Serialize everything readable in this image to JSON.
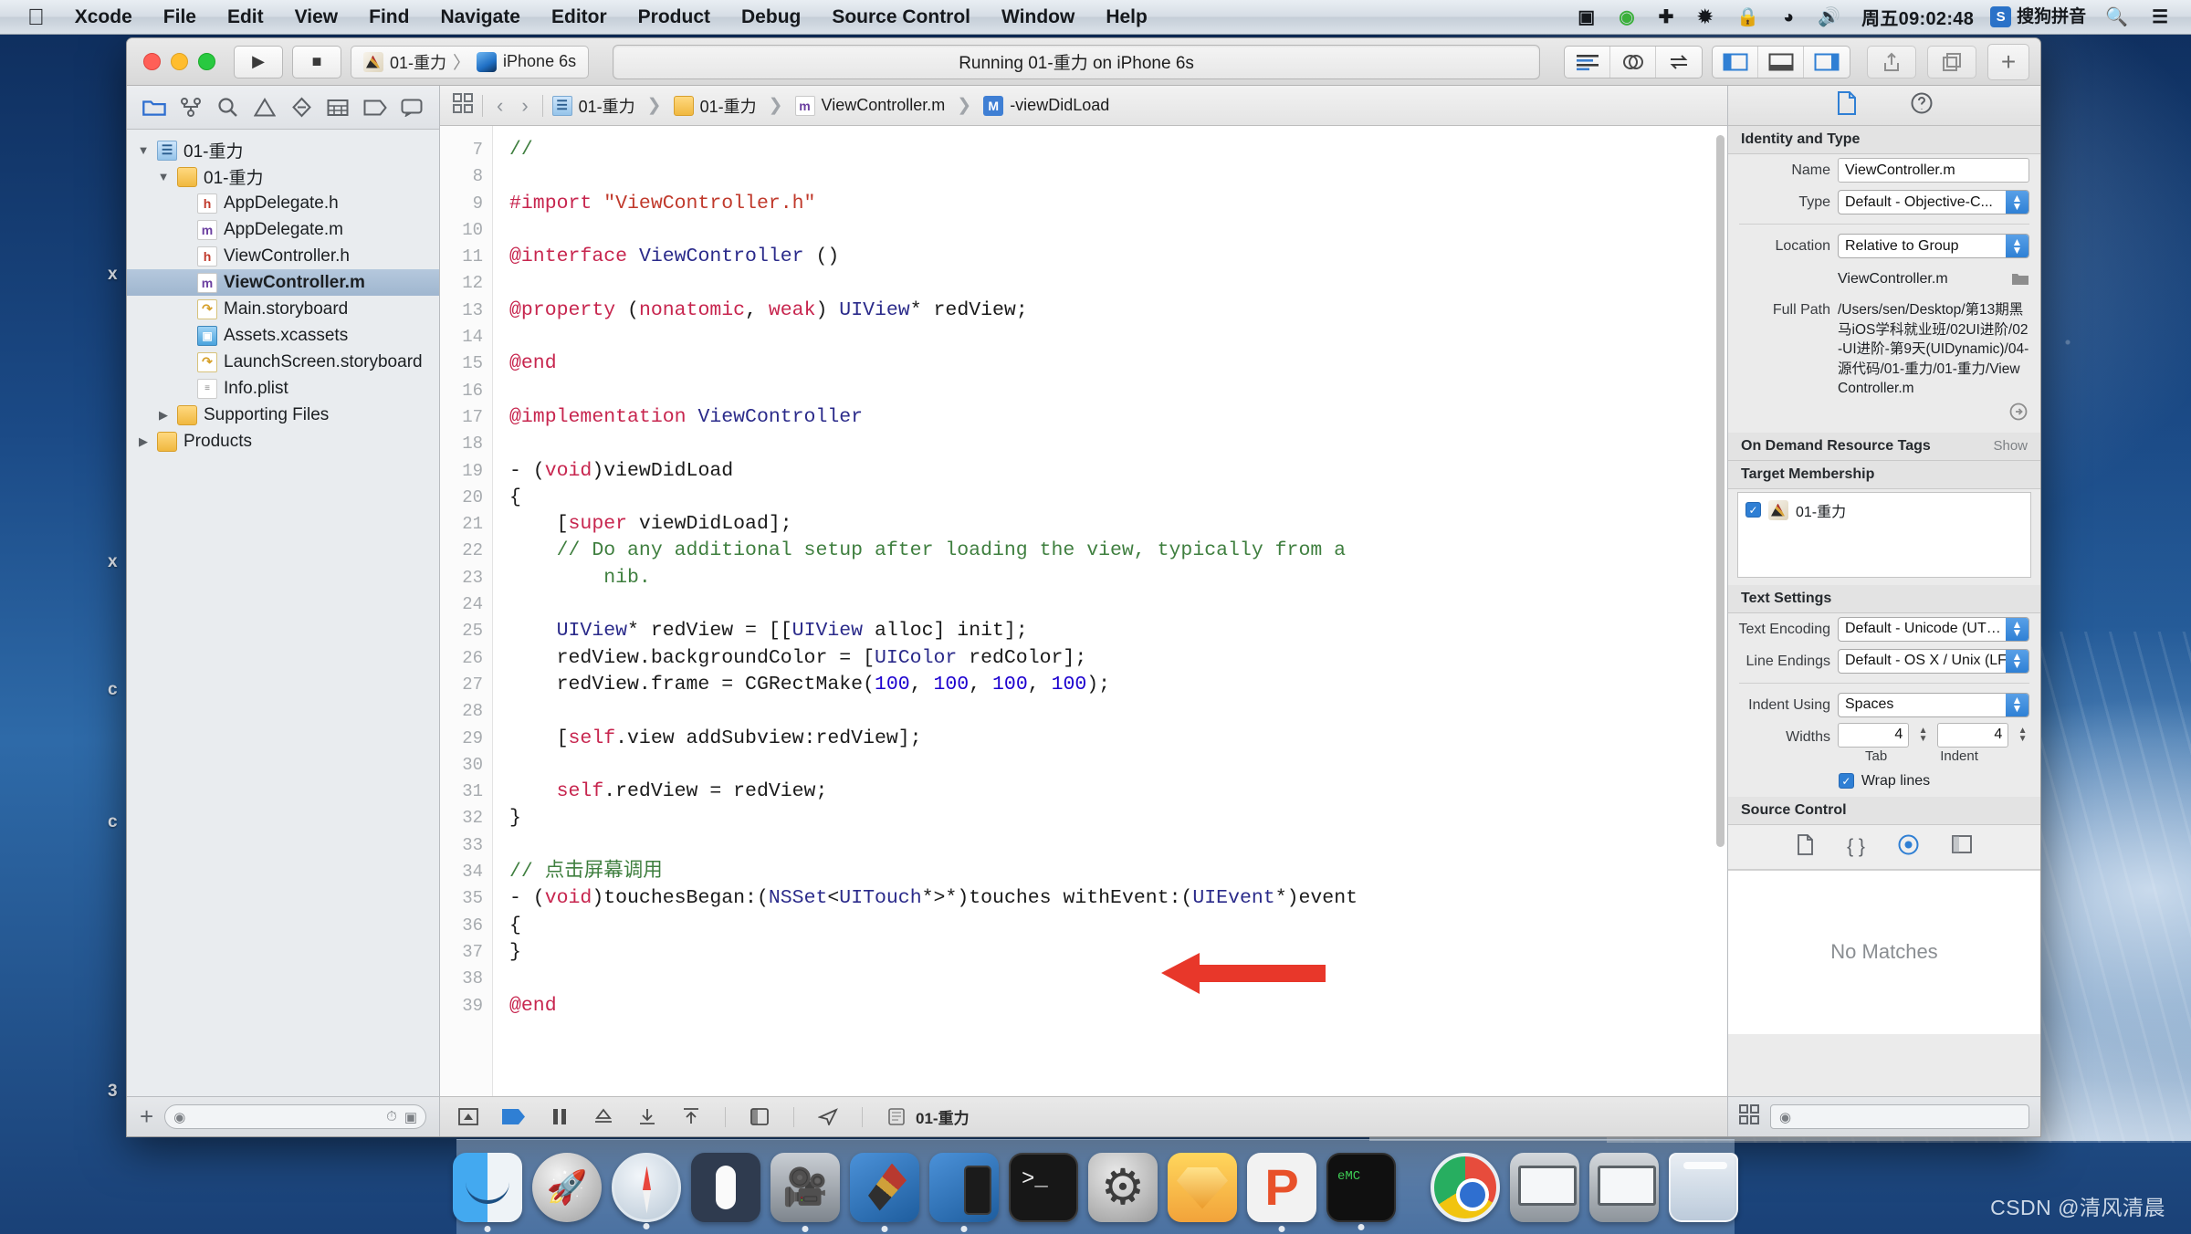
{
  "menubar": {
    "apple_icon": "apple-logo",
    "items": [
      "Xcode",
      "File",
      "Edit",
      "View",
      "Find",
      "Navigate",
      "Editor",
      "Product",
      "Debug",
      "Source Control",
      "Window",
      "Help"
    ],
    "status_icons": [
      "screen-recording-icon",
      "play-circle-icon",
      "airplane-icon",
      "bluetooth-icon",
      "lock-icon",
      "wifi-icon",
      "volume-icon"
    ],
    "clock": "周五09:02:48",
    "ime_badge": "S",
    "ime_label": "搜狗拼音",
    "search_icon": "search-icon",
    "control_center_icon": "list-icon"
  },
  "toolbar": {
    "run_icon": "play-icon",
    "stop_icon": "stop-icon",
    "scheme_name": "01-重力",
    "scheme_separator": "〉",
    "destination": "iPhone 6s",
    "status_text": "Running 01-重力 on iPhone 6s",
    "editor_modes": [
      "standard-editor-icon",
      "assistant-editor-icon",
      "version-editor-icon"
    ],
    "panel_toggles": [
      "navigator-toggle-icon",
      "debug-area-toggle-icon",
      "inspector-toggle-icon"
    ],
    "share_icon": "share-icon",
    "organizer_icon": "organizer-icon",
    "add_icon": "+"
  },
  "navigator": {
    "tabs": [
      "folder-icon",
      "source-control-icon",
      "search-icon",
      "warning-icon",
      "test-icon",
      "debug-icon",
      "breakpoint-icon",
      "report-icon"
    ],
    "active_tab_index": 0,
    "tree": [
      {
        "label": "01-重力",
        "icon": "project-icon",
        "depth": 0,
        "twisty": "▼",
        "selected": false
      },
      {
        "label": "01-重力",
        "icon": "folder-icon",
        "depth": 1,
        "twisty": "▼",
        "selected": false
      },
      {
        "label": "AppDelegate.h",
        "icon": "header-file-icon",
        "depth": 2,
        "twisty": "",
        "selected": false
      },
      {
        "label": "AppDelegate.m",
        "icon": "implementation-file-icon",
        "depth": 2,
        "twisty": "",
        "selected": false
      },
      {
        "label": "ViewController.h",
        "icon": "header-file-icon",
        "depth": 2,
        "twisty": "",
        "selected": false
      },
      {
        "label": "ViewController.m",
        "icon": "implementation-file-icon",
        "depth": 2,
        "twisty": "",
        "selected": true
      },
      {
        "label": "Main.storyboard",
        "icon": "storyboard-icon",
        "depth": 2,
        "twisty": "",
        "selected": false
      },
      {
        "label": "Assets.xcassets",
        "icon": "assets-icon",
        "depth": 2,
        "twisty": "",
        "selected": false
      },
      {
        "label": "LaunchScreen.storyboard",
        "icon": "storyboard-icon",
        "depth": 2,
        "twisty": "",
        "selected": false
      },
      {
        "label": "Info.plist",
        "icon": "plist-icon",
        "depth": 2,
        "twisty": "",
        "selected": false
      },
      {
        "label": "Supporting Files",
        "icon": "folder-icon",
        "depth": 1,
        "twisty": "▶",
        "selected": false
      },
      {
        "label": "Products",
        "icon": "folder-icon",
        "depth": 0,
        "twisty": "▶",
        "selected": false
      }
    ],
    "footer": {
      "add_icon": "+",
      "filter_placeholder": "",
      "filter_value": "",
      "filter_left_icon": "filter-icon",
      "filter_right_icon": "recent-files-icon"
    }
  },
  "jumpbar": {
    "grid_icon": "related-items-icon",
    "back_icon": "‹",
    "forward_icon": "›",
    "crumbs": [
      {
        "label": "01-重力",
        "icon": "project-icon"
      },
      {
        "label": "01-重力",
        "icon": "folder-icon"
      },
      {
        "label": "ViewController.m",
        "icon": "implementation-file-icon"
      },
      {
        "label": "-viewDidLoad",
        "icon": "method-badge-icon"
      }
    ]
  },
  "code": {
    "first_line_number": 7,
    "lines": [
      {
        "n": 7,
        "tokens": [
          {
            "t": "//",
            "c": "cm"
          }
        ]
      },
      {
        "n": 8,
        "tokens": []
      },
      {
        "n": 9,
        "tokens": [
          {
            "t": "#import ",
            "c": "kw"
          },
          {
            "t": "\"ViewController.h\"",
            "c": "str"
          }
        ]
      },
      {
        "n": 10,
        "tokens": []
      },
      {
        "n": 11,
        "tokens": [
          {
            "t": "@interface ",
            "c": "kw"
          },
          {
            "t": "ViewController",
            "c": "type"
          },
          {
            "t": " ()",
            "c": ""
          }
        ]
      },
      {
        "n": 12,
        "tokens": []
      },
      {
        "n": 13,
        "tokens": [
          {
            "t": "@property",
            "c": "kw"
          },
          {
            "t": " (",
            "c": ""
          },
          {
            "t": "nonatomic",
            "c": "kw"
          },
          {
            "t": ", ",
            "c": ""
          },
          {
            "t": "weak",
            "c": "kw"
          },
          {
            "t": ") ",
            "c": ""
          },
          {
            "t": "UIView",
            "c": "type"
          },
          {
            "t": "* redView;",
            "c": ""
          }
        ]
      },
      {
        "n": 14,
        "tokens": []
      },
      {
        "n": 15,
        "tokens": [
          {
            "t": "@end",
            "c": "kw"
          }
        ]
      },
      {
        "n": 16,
        "tokens": []
      },
      {
        "n": 17,
        "tokens": [
          {
            "t": "@implementation ",
            "c": "kw"
          },
          {
            "t": "ViewController",
            "c": "type"
          }
        ]
      },
      {
        "n": 18,
        "tokens": []
      },
      {
        "n": 19,
        "tokens": [
          {
            "t": "- (",
            "c": ""
          },
          {
            "t": "void",
            "c": "kw"
          },
          {
            "t": ")viewDidLoad",
            "c": ""
          }
        ]
      },
      {
        "n": 20,
        "tokens": [
          {
            "t": "{",
            "c": ""
          }
        ]
      },
      {
        "n": 21,
        "tokens": [
          {
            "t": "    [",
            "c": ""
          },
          {
            "t": "super",
            "c": "kw"
          },
          {
            "t": " viewDidLoad];",
            "c": ""
          }
        ]
      },
      {
        "n": 22,
        "tokens": [
          {
            "t": "    // Do any additional setup after loading the view, typically from a",
            "c": "cm"
          }
        ]
      },
      {
        "n": "",
        "tokens": [
          {
            "t": "        nib.",
            "c": "cm"
          }
        ]
      },
      {
        "n": 23,
        "tokens": []
      },
      {
        "n": 24,
        "tokens": [
          {
            "t": "    ",
            "c": ""
          },
          {
            "t": "UIView",
            "c": "type"
          },
          {
            "t": "* redView = [[",
            "c": ""
          },
          {
            "t": "UIView",
            "c": "type"
          },
          {
            "t": " alloc] init];",
            "c": ""
          }
        ]
      },
      {
        "n": 25,
        "tokens": [
          {
            "t": "    redView.backgroundColor = [",
            "c": ""
          },
          {
            "t": "UIColor",
            "c": "type"
          },
          {
            "t": " redColor];",
            "c": ""
          }
        ]
      },
      {
        "n": 26,
        "tokens": [
          {
            "t": "    redView.frame = CGRectMake(",
            "c": ""
          },
          {
            "t": "100",
            "c": "num"
          },
          {
            "t": ", ",
            "c": ""
          },
          {
            "t": "100",
            "c": "num"
          },
          {
            "t": ", ",
            "c": ""
          },
          {
            "t": "100",
            "c": "num"
          },
          {
            "t": ", ",
            "c": ""
          },
          {
            "t": "100",
            "c": "num"
          },
          {
            "t": ");",
            "c": ""
          }
        ]
      },
      {
        "n": 27,
        "tokens": []
      },
      {
        "n": 28,
        "tokens": [
          {
            "t": "    [",
            "c": ""
          },
          {
            "t": "self",
            "c": "kw"
          },
          {
            "t": ".view addSubview:redView];",
            "c": ""
          }
        ]
      },
      {
        "n": 29,
        "tokens": []
      },
      {
        "n": 30,
        "tokens": [
          {
            "t": "    ",
            "c": ""
          },
          {
            "t": "self",
            "c": "kw"
          },
          {
            "t": ".redView = redView;",
            "c": ""
          }
        ]
      },
      {
        "n": 31,
        "tokens": [
          {
            "t": "}",
            "c": ""
          }
        ]
      },
      {
        "n": 32,
        "tokens": []
      },
      {
        "n": 33,
        "tokens": [
          {
            "t": "// 点击屏幕调用",
            "c": "cm"
          }
        ]
      },
      {
        "n": 34,
        "tokens": [
          {
            "t": "- (",
            "c": ""
          },
          {
            "t": "void",
            "c": "kw"
          },
          {
            "t": ")touchesBegan:(",
            "c": ""
          },
          {
            "t": "NSSet",
            "c": "type"
          },
          {
            "t": "<",
            "c": ""
          },
          {
            "t": "UITouch",
            "c": "type"
          },
          {
            "t": "*>*)touches withEvent:(",
            "c": ""
          },
          {
            "t": "UIEvent",
            "c": "type"
          },
          {
            "t": "*)event",
            "c": ""
          }
        ]
      },
      {
        "n": 35,
        "tokens": [
          {
            "t": "{",
            "c": ""
          }
        ]
      },
      {
        "n": 36,
        "tokens": [
          {
            "t": "}",
            "c": ""
          }
        ]
      },
      {
        "n": 37,
        "tokens": []
      },
      {
        "n": 38,
        "tokens": [
          {
            "t": "@end",
            "c": "kw"
          }
        ]
      },
      {
        "n": 39,
        "tokens": []
      }
    ]
  },
  "editor_footer": {
    "icons": [
      "console-icon",
      "breakpoint-icon",
      "pause-icon",
      "step-over-icon",
      "step-into-icon",
      "step-out-icon",
      "split-icon",
      "location-icon",
      "process-icon"
    ],
    "process_label": "01-重力"
  },
  "inspector": {
    "tabs": [
      "file-inspector-icon",
      "quick-help-icon"
    ],
    "active_tab_index": 0,
    "identity_section": {
      "title": "Identity and Type",
      "name_label": "Name",
      "name_value": "ViewController.m",
      "type_label": "Type",
      "type_value": "Default - Objective-C...",
      "location_label": "Location",
      "location_value": "Relative to Group",
      "file_name": "ViewController.m",
      "choose_folder_icon": "folder-icon",
      "full_path_label": "Full Path",
      "full_path_value": "/Users/sen/Desktop/第13期黑马iOS学科就业班/02UI进阶/02-UI进阶-第9天(UIDynamic)/04-源代码/01-重力/01-重力/ViewController.m",
      "reveal_icon": "reveal-icon"
    },
    "on_demand_section": {
      "title": "On Demand Resource Tags",
      "action": "Show"
    },
    "target_membership": {
      "title": "Target Membership",
      "items": [
        {
          "label": "01-重力",
          "checked": true,
          "icon": "target-icon"
        }
      ]
    },
    "text_settings": {
      "title": "Text Settings",
      "text_encoding_label": "Text Encoding",
      "text_encoding_value": "Default - Unicode (UT…",
      "line_endings_label": "Line Endings",
      "line_endings_value": "Default - OS X / Unix (LF)",
      "indent_using_label": "Indent Using",
      "indent_using_value": "Spaces",
      "widths_label": "Widths",
      "tab_width": "4",
      "indent_width": "4",
      "tab_sublabel": "Tab",
      "indent_sublabel": "Indent",
      "wrap_lines_label": "Wrap lines",
      "wrap_lines_checked": true
    },
    "source_control": {
      "title": "Source Control",
      "icons": [
        "file-icon",
        "braces-icon",
        "target-circle-icon",
        "panel-icon"
      ],
      "active_icon_index": 2
    },
    "quick_help": {
      "empty_message": "No Matches"
    },
    "footer": {
      "left_icon": "library-grid-icon",
      "filter_icon": "filter-icon",
      "filter_value": ""
    }
  },
  "annotation": {
    "arrow_color": "#e8372a",
    "points_to_line": 30
  },
  "dock": {
    "items": [
      {
        "name": "Finder",
        "icon": "finder-icon",
        "running": true
      },
      {
        "name": "Launchpad",
        "icon": "launchpad-icon",
        "running": false
      },
      {
        "name": "Safari",
        "icon": "safari-icon",
        "running": true
      },
      {
        "name": "Magic Mouse Utility",
        "icon": "mouse-icon",
        "running": false
      },
      {
        "name": "QuickTime Player",
        "icon": "quicktime-icon",
        "running": true
      },
      {
        "name": "Xcode",
        "icon": "xcode-icon",
        "running": true
      },
      {
        "name": "Simulator",
        "icon": "simulator-icon",
        "running": true
      },
      {
        "name": "Terminal",
        "icon": "terminal-icon",
        "running": false
      },
      {
        "name": "System Preferences",
        "icon": "system-preferences-icon",
        "running": false
      },
      {
        "name": "Sketch",
        "icon": "sketch-icon",
        "running": false
      },
      {
        "name": "Principle",
        "icon": "principle-icon",
        "running": true
      },
      {
        "name": "iTerm",
        "icon": "iterm-icon",
        "running": true
      }
    ],
    "right_items": [
      {
        "name": "Chrome Download",
        "icon": "chrome-icon"
      },
      {
        "name": "Finder Window 1",
        "icon": "window-icon"
      },
      {
        "name": "Finder Window 2",
        "icon": "window-icon"
      },
      {
        "name": "Trash",
        "icon": "trash-icon"
      }
    ],
    "separator": true
  },
  "desktop": {
    "stray_labels": [
      "x",
      "x",
      "c",
      "c",
      "3"
    ],
    "watermark": "CSDN @清风清晨"
  },
  "colors": {
    "accent": "#2f7fd4",
    "selection": "#a9c0d8",
    "annotation_red": "#e8372a",
    "comment_green": "#3f7f3f",
    "keyword_pink": "#c7254e",
    "string_red": "#c0392b",
    "number_blue": "#1c00cf"
  }
}
